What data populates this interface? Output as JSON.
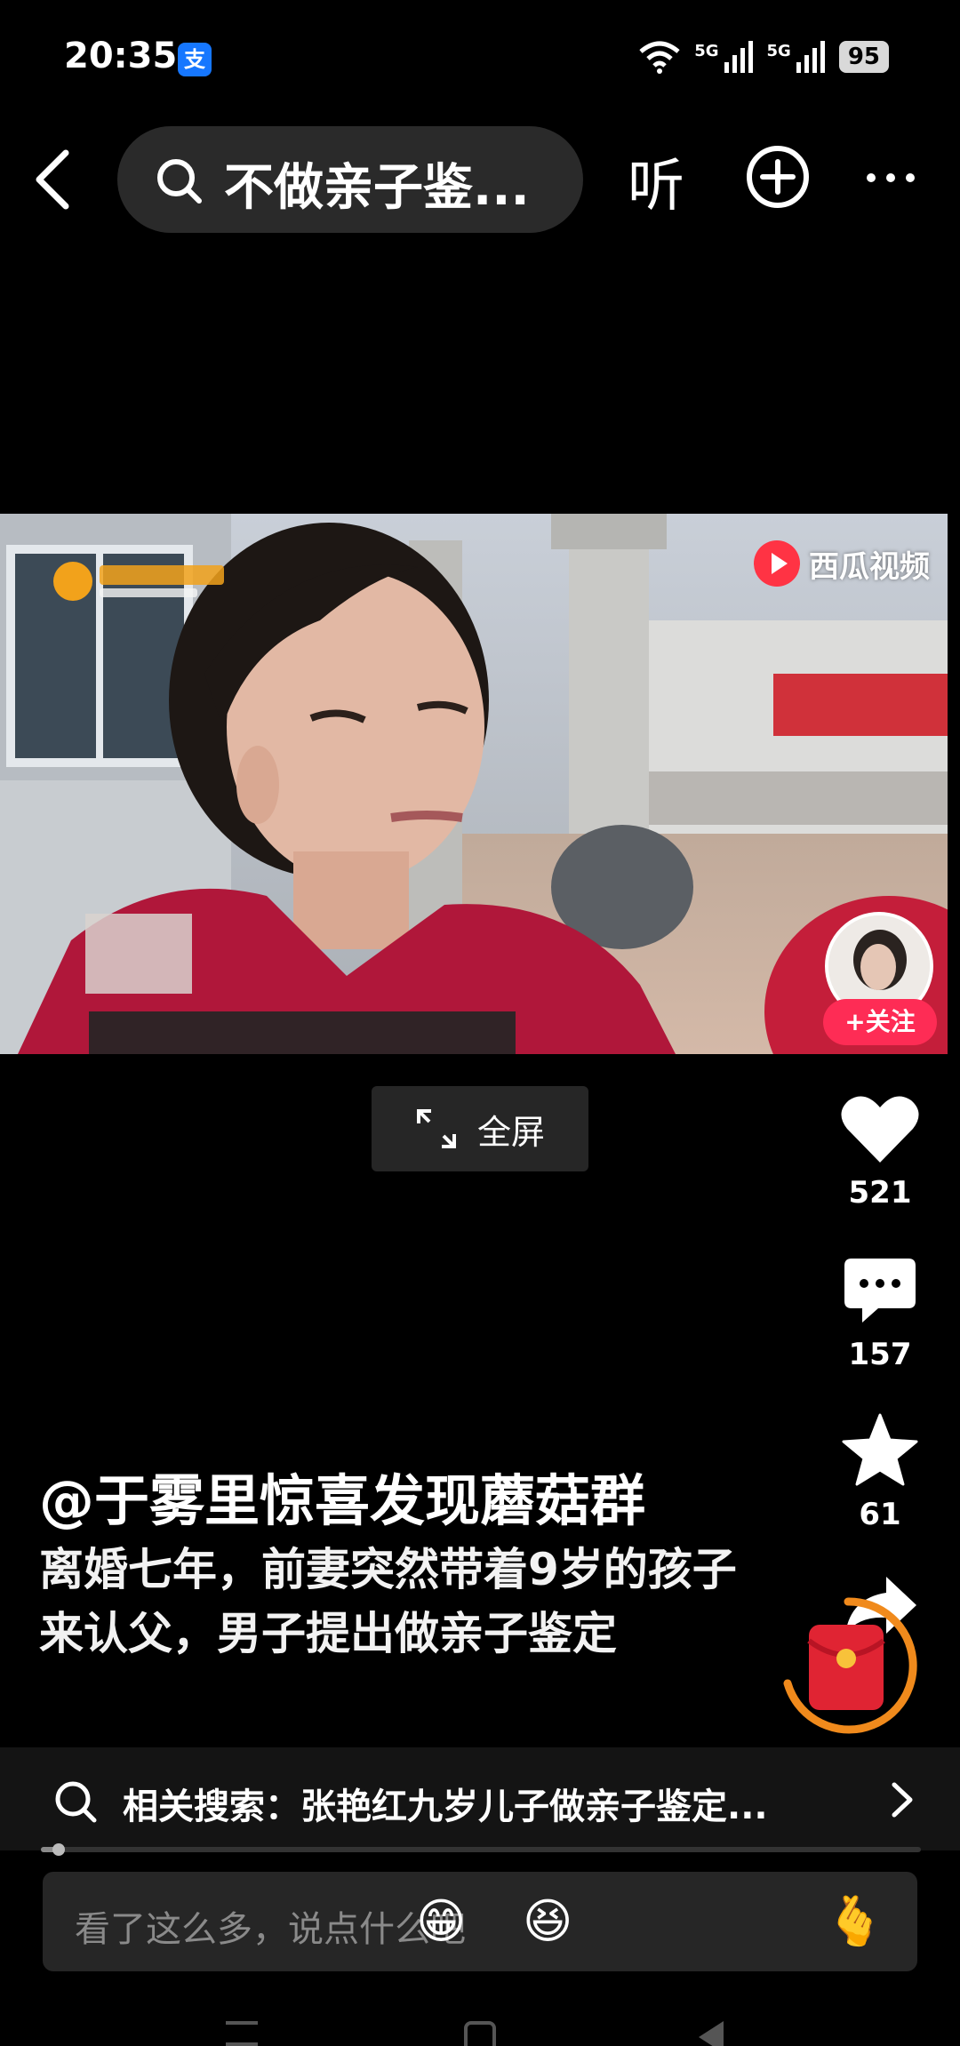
{
  "status_bar": {
    "time": "20:35",
    "app_badge": "支",
    "net1": "5G",
    "net2": "5G",
    "battery": "95"
  },
  "top_nav": {
    "search_text": "不做亲子鉴...",
    "listen_label": "听"
  },
  "video": {
    "watermark": "西瓜视频",
    "follow_label": "+关注"
  },
  "fullscreen_label": "全屏",
  "actions": {
    "likes": "521",
    "comments": "157",
    "collects": "61"
  },
  "post": {
    "author": "@于雾里惊喜发现蘑菇群",
    "caption": "离婚七年，前妻突然带着9岁的孩子来认父，男子提出做亲子鉴定"
  },
  "related_search": {
    "text": "相关搜索：张艳红九岁儿子做亲子鉴定..."
  },
  "progress": 0.02,
  "comment_box": {
    "placeholder": "看了这么多，说点什么吧",
    "emojis": [
      "😁",
      "😆",
      "🫰"
    ]
  }
}
